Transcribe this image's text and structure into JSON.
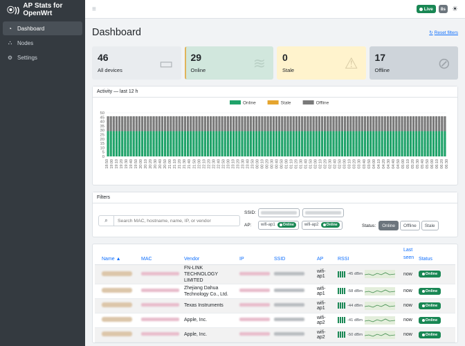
{
  "app": {
    "title": "AP Stats for OpenWrt"
  },
  "sidebar": {
    "items": [
      {
        "label": "Dashboard",
        "icon": "gauge-icon",
        "active": true
      },
      {
        "label": "Nodes",
        "icon": "nodes-icon",
        "active": false
      },
      {
        "label": "Settings",
        "icon": "gear-icon",
        "active": false
      }
    ]
  },
  "header": {
    "live_label": "Live",
    "interval_label": "8s"
  },
  "page": {
    "title": "Dashboard",
    "reset_label": "Reset filters"
  },
  "stats": {
    "all": {
      "value": "46",
      "label": "All devices"
    },
    "online": {
      "value": "29",
      "label": "Online"
    },
    "stale": {
      "value": "0",
      "label": "Stale"
    },
    "offline": {
      "value": "17",
      "label": "Offline"
    }
  },
  "activity": {
    "title": "Activity — last 12 h"
  },
  "chart_data": {
    "type": "bar",
    "stacked": true,
    "legend_position": "top",
    "ylim": [
      0,
      50
    ],
    "yticks": [
      0,
      5,
      10,
      15,
      20,
      25,
      30,
      35,
      40,
      45,
      50
    ],
    "categories": [
      "18:50",
      "19:00",
      "19:10",
      "19:20",
      "19:30",
      "19:40",
      "19:50",
      "20:00",
      "20:10",
      "20:20",
      "20:30",
      "20:40",
      "20:50",
      "21:00",
      "21:10",
      "21:20",
      "21:30",
      "21:40",
      "21:50",
      "22:00",
      "22:10",
      "22:20",
      "22:30",
      "22:40",
      "22:50",
      "23:00",
      "23:10",
      "23:20",
      "23:30",
      "23:40",
      "23:50",
      "00:00",
      "00:10",
      "00:20",
      "00:30",
      "00:40",
      "00:50",
      "01:00",
      "01:10",
      "01:20",
      "01:30",
      "01:40",
      "01:50",
      "02:00",
      "02:10",
      "02:20",
      "02:30",
      "02:40",
      "02:50",
      "03:00",
      "03:10",
      "03:20",
      "03:30",
      "03:40",
      "03:50",
      "04:00",
      "04:10",
      "04:20",
      "04:30",
      "04:40",
      "04:50",
      "05:00",
      "05:10",
      "05:20",
      "05:30",
      "05:40",
      "05:50",
      "06:00",
      "06:10",
      "06:20",
      "06:30"
    ],
    "series": [
      {
        "name": "Online",
        "color": "#20a36a",
        "value": 29
      },
      {
        "name": "Stale",
        "color": "#e5a52f",
        "value": 0
      },
      {
        "name": "Offline",
        "color": "#7a7a7a",
        "value": 17
      }
    ]
  },
  "filters": {
    "title": "Filters",
    "search_placeholder": "Search MAC, hostname, name, IP, or vendor",
    "ssid_label": "SSID:",
    "ap_label": "AP:",
    "aps": [
      {
        "name": "wifi-ap1",
        "status": "Online"
      },
      {
        "name": "wifi-ap2",
        "status": "Online"
      }
    ],
    "status_label": "Status:",
    "status_options": [
      "Online",
      "Offline",
      "Stale"
    ]
  },
  "table": {
    "columns": {
      "name": "Name ▲",
      "mac": "MAC",
      "vendor": "Vendor",
      "ip": "IP",
      "ssid": "SSID",
      "ap": "AP",
      "rssi": "RSSI",
      "last_seen": "Last seen",
      "status": "Status"
    },
    "rows": [
      {
        "vendor": "FN-LINK TECHNOLOGY LIMITED",
        "ap": "wifi-ap1",
        "rssi": "-45 dBm",
        "last_seen": "now",
        "status": "Online"
      },
      {
        "vendor": "Zhejiang Dahua Technology Co., Ltd.",
        "ap": "wifi-ap1",
        "rssi": "-58 dBm",
        "last_seen": "now",
        "status": "Online"
      },
      {
        "vendor": "Texas Instruments",
        "ap": "wifi-ap1",
        "rssi": "-44 dBm",
        "last_seen": "now",
        "status": "Online"
      },
      {
        "vendor": "Apple, Inc.",
        "ap": "wifi-ap2",
        "rssi": "-41 dBm",
        "last_seen": "now",
        "status": "Online"
      },
      {
        "vendor": "Apple, Inc.",
        "ap": "wifi-ap2",
        "rssi": "-50 dBm",
        "last_seen": "now",
        "status": "Online"
      }
    ]
  }
}
